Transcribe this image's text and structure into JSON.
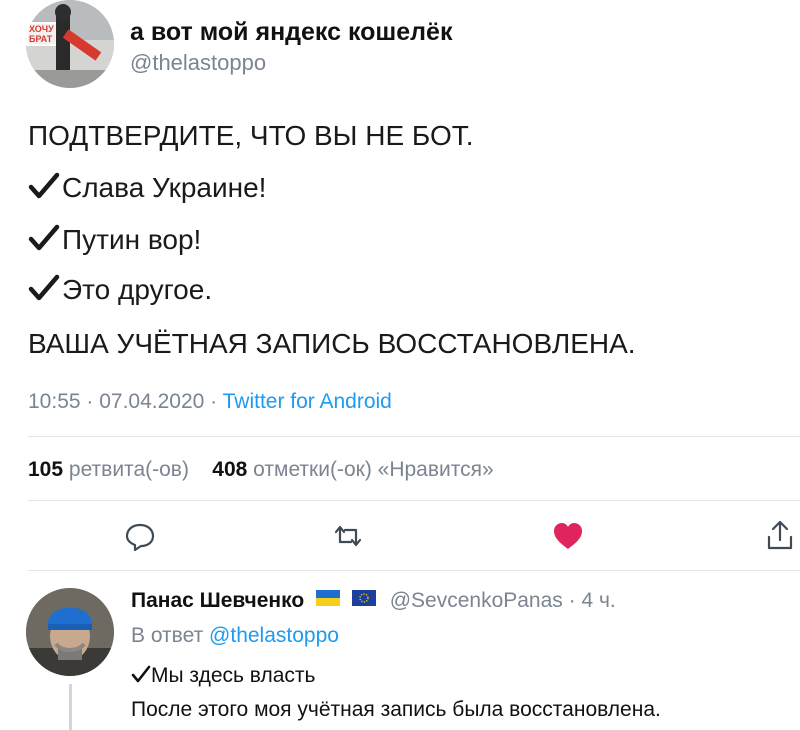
{
  "tweet": {
    "display_name": "а вот мой яндекс кошелёк",
    "handle": "@thelastoppo",
    "lines": [
      "ПОДТВЕРДИТЕ, ЧТО ВЫ НЕ БОТ.",
      "Слава Украине!",
      "Путин вор!",
      "Это другое.",
      "ВАША УЧЁТНАЯ ЗАПИСЬ ВОССТАНОВЛЕНА."
    ],
    "time": "10:55 · 07.04.2020 · ",
    "source": "Twitter for Android",
    "retweets_count": "105",
    "retweets_label": "ретвита(-ов)",
    "likes_count": "408",
    "likes_label": "отметки(-ок) «Нравится»",
    "avatar_sign_text": "ХОЧУ БРАТ"
  },
  "actions": {
    "reply_icon": "speech-bubble-icon",
    "retweet_icon": "retweet-icon",
    "like_icon": "heart-icon",
    "share_icon": "share-icon",
    "like_color": "#e0245e"
  },
  "reply": {
    "display_name": "Панас Шевченко",
    "handle_time": "@SevcenkoPanas · 4 ч.",
    "in_reply_prefix": "В ответ ",
    "in_reply_handle": "@thelastoppo",
    "line1": "Мы здесь власть",
    "line2": "После этого моя учётная запись была восстановлена."
  },
  "colors": {
    "link": "#1d9bf0",
    "secondary_text": "#7a8591"
  }
}
